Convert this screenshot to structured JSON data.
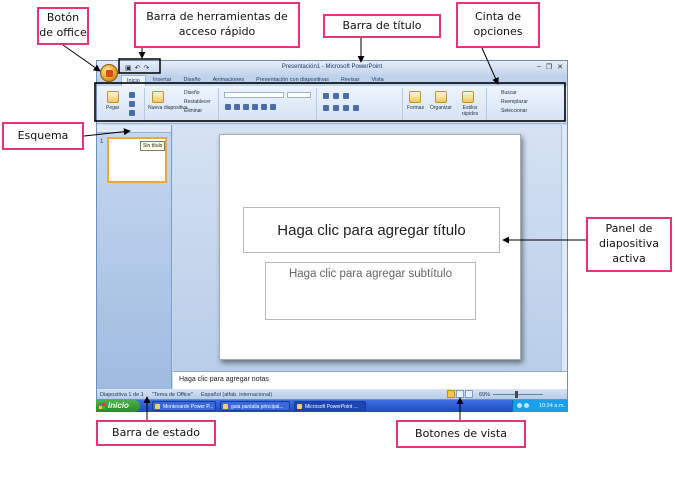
{
  "callouts": {
    "office_button": "Botón de office",
    "quick_access": "Barra de herramientas de acceso rápido",
    "title_bar": "Barra de título",
    "ribbon": "Cinta de opciones",
    "outline": "Esquema",
    "active_slide": "Panel de diapositiva activa",
    "status_bar": "Barra de estado",
    "view_buttons": "Botones de vista"
  },
  "window": {
    "title": "Presentación1 - Microsoft PowerPoint",
    "controls": [
      "–",
      "❐",
      "✕"
    ],
    "tabs": [
      {
        "label": "Inicio",
        "active": true
      },
      {
        "label": "Insertar"
      },
      {
        "label": "Diseño"
      },
      {
        "label": "Animaciones"
      },
      {
        "label": "Presentación con diapositivas"
      },
      {
        "label": "Revisar"
      },
      {
        "label": "Vista"
      }
    ],
    "ribbon": {
      "paste": "Pegar",
      "new_slide": "Nueva diapositiva",
      "layout": "Diseño",
      "reset": "Restablecer",
      "delete": "Eliminar",
      "shapes": "Formas",
      "arrange": "Organizar",
      "quick_styles": "Estilos rápidos",
      "find": "Buscar",
      "replace": "Reemplazar",
      "select": "Seleccionar"
    },
    "thumb": {
      "number": "1",
      "tooltip": "Sin título"
    },
    "slide": {
      "title_placeholder": "Haga clic para agregar título",
      "subtitle_placeholder": "Haga clic para agregar subtítulo"
    },
    "notes_placeholder": "Haga clic para agregar notas",
    "status": {
      "slide": "Diapositiva 1 de 1",
      "theme": "\"Tema de Office\"",
      "language": "Español (alfab. internacional)",
      "zoom": "69%"
    }
  },
  "taskbar": {
    "start": "Inicio",
    "items": [
      {
        "label": "Montevarde Power P..."
      },
      {
        "label": "guia pantalla principal..."
      },
      {
        "label": "Microsoft PowerPoint ...",
        "active": true
      }
    ],
    "clock": "10:24 a.m."
  }
}
